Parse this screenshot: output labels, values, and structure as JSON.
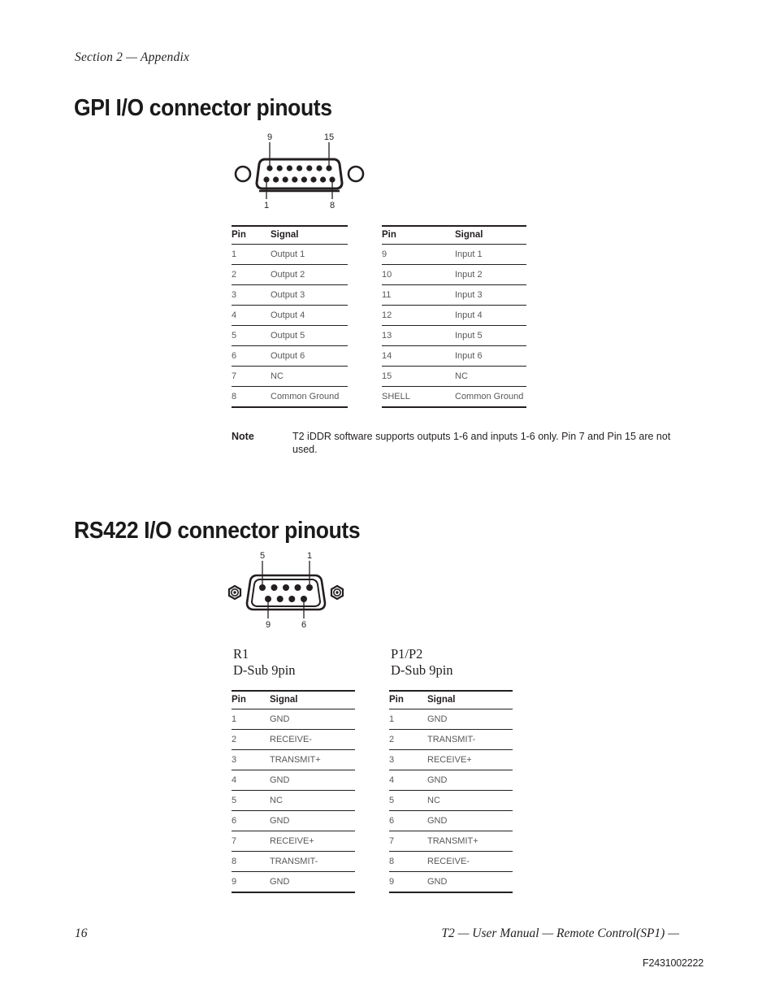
{
  "running_head": "Section 2 — Appendix",
  "sections": [
    {
      "title": "GPI I/O connector pinouts"
    },
    {
      "title": "RS422 I/O connector pinouts"
    }
  ],
  "gpi": {
    "connector": {
      "type": "DB15",
      "top_left_label": "9",
      "top_right_label": "15",
      "bottom_left_label": "1",
      "bottom_right_label": "8",
      "top_row_pins": 7,
      "bottom_row_pins": 8
    },
    "table_left": {
      "columns": [
        "Pin",
        "Signal"
      ],
      "rows": [
        [
          "1",
          "Output 1"
        ],
        [
          "2",
          "Output 2"
        ],
        [
          "3",
          "Output 3"
        ],
        [
          "4",
          "Output 4"
        ],
        [
          "5",
          "Output 5"
        ],
        [
          "6",
          "Output 6"
        ],
        [
          "7",
          "NC"
        ],
        [
          "8",
          "Common Ground"
        ]
      ]
    },
    "table_right": {
      "columns": [
        "Pin",
        "Signal"
      ],
      "rows": [
        [
          "9",
          "Input 1"
        ],
        [
          "10",
          "Input 2"
        ],
        [
          "11",
          "Input 3"
        ],
        [
          "12",
          "Input 4"
        ],
        [
          "13",
          "Input 5"
        ],
        [
          "14",
          "Input 6"
        ],
        [
          "15",
          "NC"
        ],
        [
          "SHELL",
          "Common Ground"
        ]
      ]
    },
    "note": {
      "label": "Note",
      "text": "T2 iDDR software supports outputs 1-6 and inputs 1-6 only. Pin 7 and Pin 15 are not used."
    }
  },
  "rs422": {
    "connector": {
      "type": "DB9",
      "top_left_label": "5",
      "top_right_label": "1",
      "bottom_left_label": "9",
      "bottom_right_label": "6",
      "top_row_pins": 5,
      "bottom_row_pins": 4
    },
    "caption_left": {
      "line1": "R1",
      "line2": "D-Sub 9pin"
    },
    "caption_right": {
      "line1": "P1/P2",
      "line2": "D-Sub 9pin"
    },
    "table_left": {
      "columns": [
        "Pin",
        "Signal"
      ],
      "rows": [
        [
          "1",
          "GND"
        ],
        [
          "2",
          "RECEIVE-"
        ],
        [
          "3",
          "TRANSMIT+"
        ],
        [
          "4",
          "GND"
        ],
        [
          "5",
          "NC"
        ],
        [
          "6",
          "GND"
        ],
        [
          "7",
          "RECEIVE+"
        ],
        [
          "8",
          "TRANSMIT-"
        ],
        [
          "9",
          "GND"
        ]
      ]
    },
    "table_right": {
      "columns": [
        "Pin",
        "Signal"
      ],
      "rows": [
        [
          "1",
          "GND"
        ],
        [
          "2",
          "TRANSMIT-"
        ],
        [
          "3",
          "RECEIVE+"
        ],
        [
          "4",
          "GND"
        ],
        [
          "5",
          "NC"
        ],
        [
          "6",
          "GND"
        ],
        [
          "7",
          "TRANSMIT+"
        ],
        [
          "8",
          "RECEIVE-"
        ],
        [
          "9",
          "GND"
        ]
      ]
    }
  },
  "footer": {
    "page_number": "16",
    "manual_line": "T2  —  User Manual  —  Remote Control(SP1)  —",
    "document_number": "F2431002222"
  },
  "colors": {
    "ink": "#231f20",
    "body_text": "#58585a",
    "background": "#ffffff"
  }
}
